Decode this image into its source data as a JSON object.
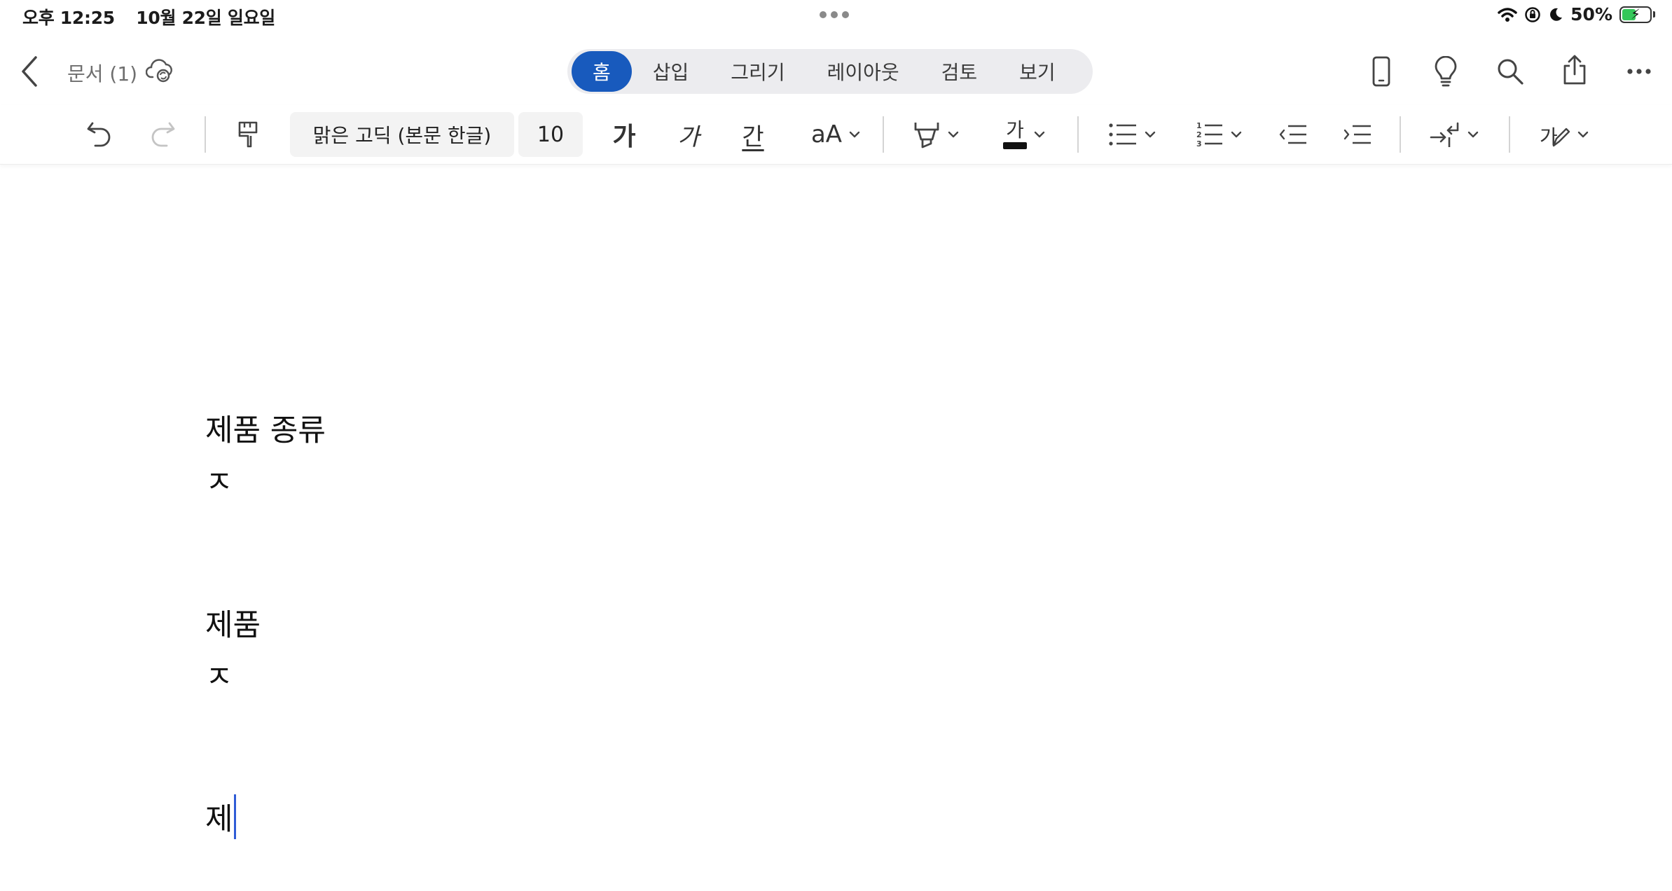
{
  "status_bar": {
    "time": "오후 12:25",
    "date": "10월 22일 일요일",
    "battery": "50%",
    "battery_level": 0.5,
    "icons": [
      "multitask-dots-icon",
      "wifi-icon",
      "orientation-lock-icon",
      "moon-icon",
      "battery-charging-icon"
    ]
  },
  "header": {
    "document_title": "문서 (1)",
    "tabs": [
      {
        "label": "홈",
        "active": true
      },
      {
        "label": "삽입",
        "active": false
      },
      {
        "label": "그리기",
        "active": false
      },
      {
        "label": "레이아웃",
        "active": false
      },
      {
        "label": "검토",
        "active": false
      },
      {
        "label": "보기",
        "active": false
      }
    ],
    "right_icons": [
      "mobile-view-icon",
      "lightbulb-icon",
      "search-icon",
      "share-icon",
      "more-icon"
    ]
  },
  "ribbon": {
    "font_name": "맑은 고딕 (본문 한글)",
    "font_size": "10",
    "bold_glyph": "가",
    "italic_glyph": "가",
    "underline_glyph": "간",
    "font_size_glyph": "aA",
    "font_color_glyph": "가",
    "style_glyph": "가",
    "icons": [
      "undo-icon",
      "redo-icon",
      "format-painter-icon",
      "highlighter-icon",
      "bullets-icon",
      "numbering-icon",
      "decrease-indent-icon",
      "increase-indent-icon",
      "paragraph-icon",
      "styles-icon"
    ],
    "colors": {
      "accent": "#185abd",
      "highlight": "#222222",
      "font_color": "#111111"
    }
  },
  "document": {
    "paragraphs": [
      "제품 종류",
      "ㅈ",
      "",
      "",
      "제품",
      "ㅈ",
      "",
      "",
      "제"
    ]
  },
  "colors": {
    "caret": "#2f5cd6",
    "tab_active": "#185abd",
    "battery_fill": "#34c759"
  }
}
